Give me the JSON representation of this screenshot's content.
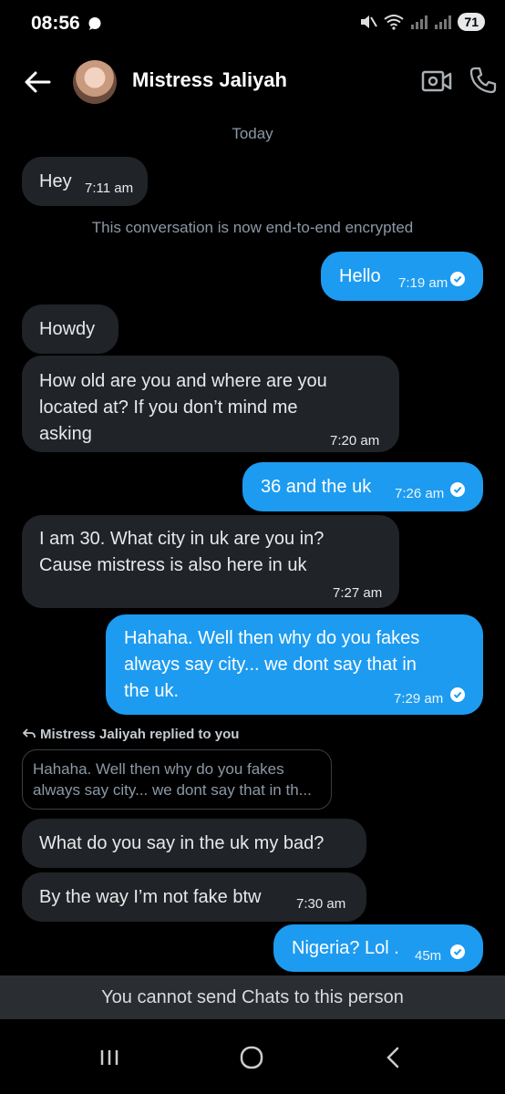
{
  "status_bar": {
    "time": "08:56",
    "battery": "71"
  },
  "header": {
    "contact_name": "Mistress Jaliyah"
  },
  "date_separator": "Today",
  "system_note": "This conversation is now end-to-end encrypted",
  "messages": [
    {
      "text": "Hey",
      "time": "7:11 am"
    },
    {
      "text": "Hello",
      "time": "7:19 am"
    },
    {
      "text": "Howdy"
    },
    {
      "line1": "How old are you and where are you",
      "line2": "located at? If you don’t mind me",
      "line3": "asking",
      "time": "7:20 am"
    },
    {
      "text": "36 and the uk",
      "time": "7:26 am"
    },
    {
      "line1": "I am 30. What city in uk are you in?",
      "line2": "Cause mistress is also here in uk",
      "time": "7:27 am"
    },
    {
      "line1": "Hahaha. Well then why do you fakes",
      "line2": "always say city... we dont say that in",
      "line3": "the uk.",
      "time": "7:29 am"
    },
    {
      "text": "What do you say in the uk my bad?"
    },
    {
      "text": "By the way I’m not fake btw",
      "time": "7:30 am"
    },
    {
      "text": "Nigeria? Lol .",
      "time": "45m"
    }
  ],
  "reply": {
    "label": "Mistress Jaliyah replied to you",
    "quote_line1": "Hahaha. Well then why do you fakes",
    "quote_line2": "always say city... we dont say that in th..."
  },
  "footer_notice": "You cannot send Chats to this person",
  "colors": {
    "accent": "#1d9bf0",
    "incoming_bubble": "#202327",
    "background": "#000000"
  }
}
